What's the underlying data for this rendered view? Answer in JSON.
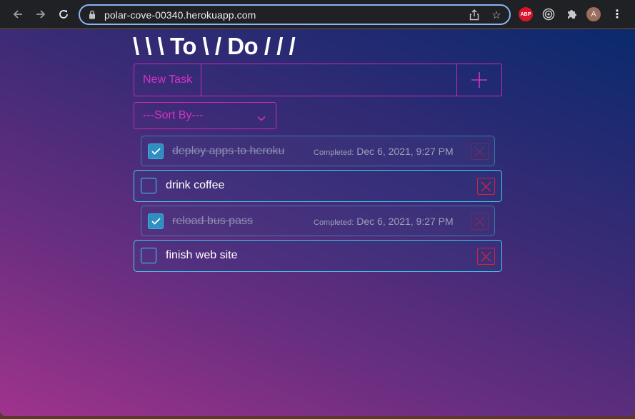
{
  "browser": {
    "url": "polar-cove-00340.herokuapp.com",
    "extensions": {
      "abp_label": "ABP",
      "avatar_initial": "A"
    }
  },
  "app": {
    "title": "\\ \\ \\ To \\ / Do / / /",
    "new_task_label": "New Task",
    "new_task_value": "",
    "sort_placeholder": "---Sort By---",
    "completed_label": "Completed:"
  },
  "tasks": [
    {
      "name": "deploy apps to heroku",
      "completed": true,
      "completed_at": "Dec 6, 2021, 9:27 PM"
    },
    {
      "name": "drink coffee",
      "completed": false
    },
    {
      "name": "reload bus pass",
      "completed": true,
      "completed_at": "Dec 6, 2021, 9:27 PM"
    },
    {
      "name": "finish web site",
      "completed": false
    }
  ],
  "colors": {
    "accent_magenta": "#c729b8",
    "accent_cyan": "#3fd0f0",
    "delete_red": "#d0243c"
  }
}
